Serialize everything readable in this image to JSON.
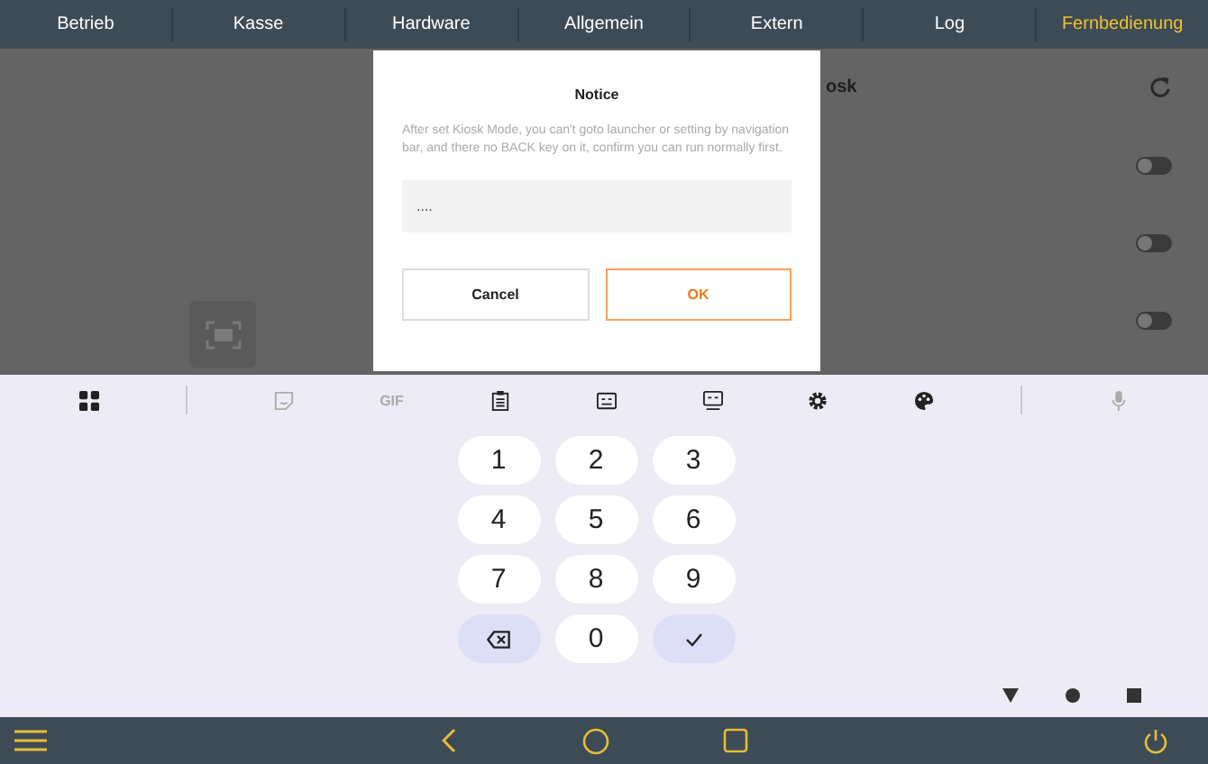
{
  "tabs": [
    {
      "label": "Betrieb",
      "selected": false
    },
    {
      "label": "Kasse",
      "selected": false
    },
    {
      "label": "Hardware",
      "selected": false
    },
    {
      "label": "Allgemein",
      "selected": false
    },
    {
      "label": "Extern",
      "selected": false
    },
    {
      "label": "Log",
      "selected": false
    },
    {
      "label": "Fernbedienung",
      "selected": true
    }
  ],
  "settings": {
    "partial_label": "osk",
    "toggles": [
      {
        "on": false
      },
      {
        "on": false
      },
      {
        "on": false
      }
    ]
  },
  "dialog": {
    "title": "Notice",
    "message": "After set Kiosk Mode, you can't goto launcher or setting by navigation bar, and there no BACK key on it, confirm you can run normally first.",
    "field_value": "....",
    "buttons": [
      {
        "label": "Cancel",
        "kind": "secondary"
      },
      {
        "label": "OK",
        "kind": "primary"
      }
    ]
  },
  "keyboard_toolbar": [
    {
      "kind": "grid",
      "disabled": false
    },
    {
      "kind": "divider"
    },
    {
      "kind": "sticker",
      "disabled": true
    },
    {
      "kind": "text",
      "label": "GIF",
      "disabled": true
    },
    {
      "kind": "clipboard",
      "disabled": false
    },
    {
      "kind": "keyboard",
      "disabled": false
    },
    {
      "kind": "screen",
      "disabled": false
    },
    {
      "kind": "gear",
      "disabled": false
    },
    {
      "kind": "palette",
      "disabled": false
    },
    {
      "kind": "divider"
    },
    {
      "kind": "mic",
      "disabled": true
    }
  ],
  "keys": [
    {
      "kind": "digit",
      "label": "1"
    },
    {
      "kind": "digit",
      "label": "2"
    },
    {
      "kind": "digit",
      "label": "3"
    },
    {
      "kind": "digit",
      "label": "4"
    },
    {
      "kind": "digit",
      "label": "5"
    },
    {
      "kind": "digit",
      "label": "6"
    },
    {
      "kind": "digit",
      "label": "7"
    },
    {
      "kind": "digit",
      "label": "8"
    },
    {
      "kind": "digit",
      "label": "9"
    },
    {
      "kind": "backspace"
    },
    {
      "kind": "digit",
      "label": "0"
    },
    {
      "kind": "enter"
    }
  ]
}
